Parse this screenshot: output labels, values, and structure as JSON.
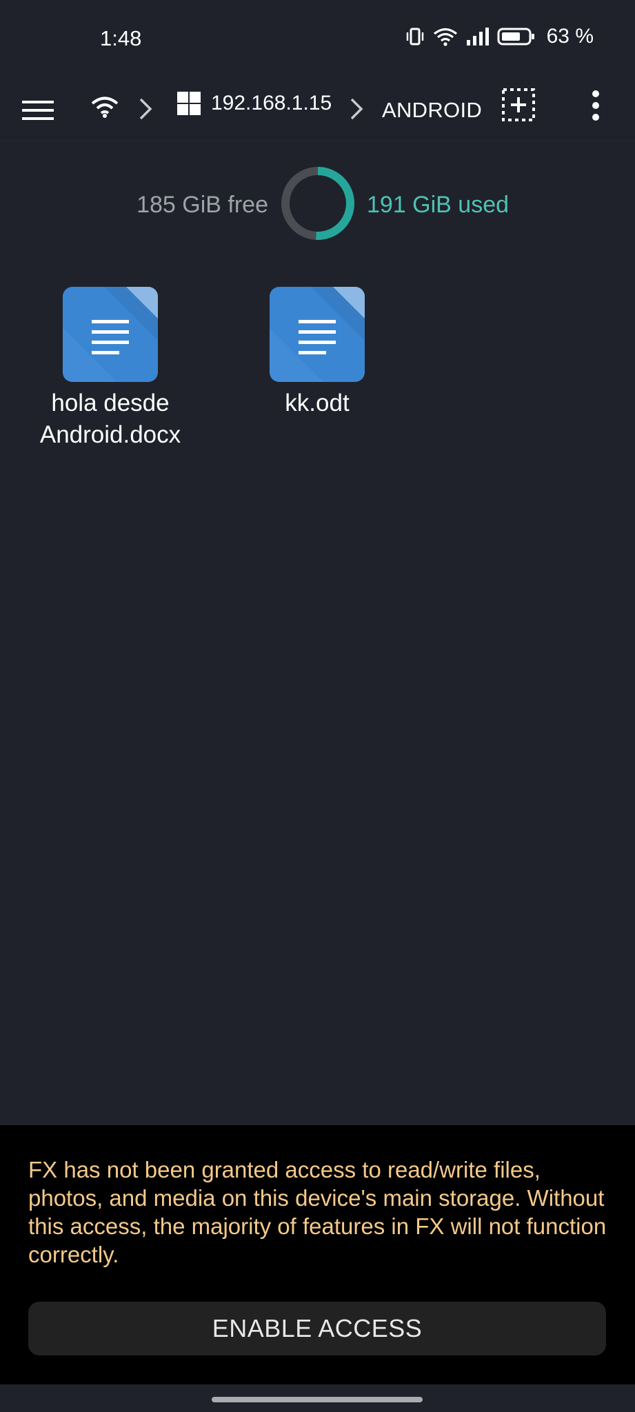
{
  "status_bar": {
    "time": "1:48",
    "battery_percent": "63 %",
    "icons": [
      "vibrate-icon",
      "wifi-icon",
      "signal-icon",
      "battery-icon"
    ]
  },
  "toolbar": {
    "menu_icon": "hamburger-menu-icon",
    "network_icon": "wifi-icon",
    "windows_icon": "windows-icon",
    "host": "192.168.1.15",
    "folder": "ANDROID",
    "select_icon": "select-add-icon",
    "more_icon": "more-vert-icon"
  },
  "storage": {
    "free_label": "185 GiB free",
    "used_label": "191 GiB used",
    "used_fraction": 0.508,
    "used_color": "#26a69a",
    "free_color": "#4a4d52"
  },
  "files": [
    {
      "name": "hola desde Android.docx",
      "icon": "document-icon"
    },
    {
      "name": "kk.odt",
      "icon": "document-icon"
    }
  ],
  "banner": {
    "message": "FX has not been granted access to read/write files, photos, and media on this device's main storage. Without this access, the majority of features in FX will not function correctly.",
    "button_label": "ENABLE ACCESS",
    "text_color": "#f5c98b"
  }
}
